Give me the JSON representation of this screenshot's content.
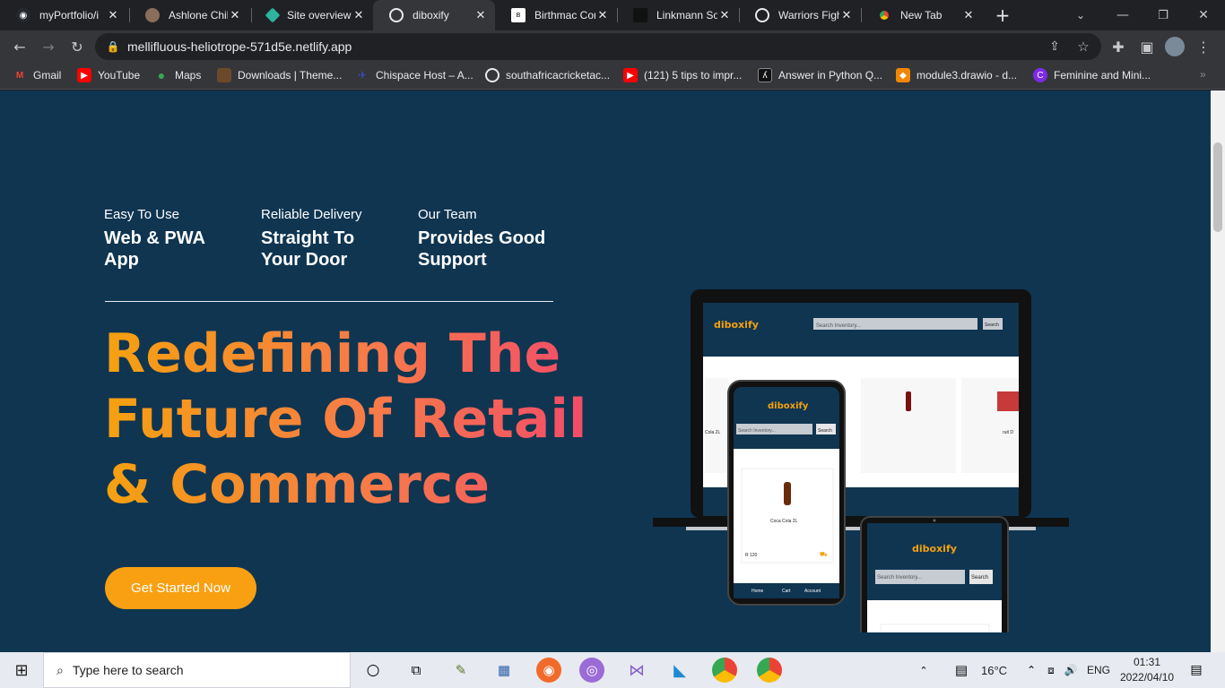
{
  "tabs": [
    {
      "title": "myPortfolio/i",
      "icon": "github-icon"
    },
    {
      "title": "Ashlone Chib",
      "icon": "person-icon"
    },
    {
      "title": "Site overview",
      "icon": "netlify-icon"
    },
    {
      "title": "diboxify",
      "icon": "globe-icon"
    },
    {
      "title": "Birthmac Con",
      "icon": "birthmac-icon"
    },
    {
      "title": "Linkmann So",
      "icon": "linkmann-icon"
    },
    {
      "title": "Warriors Figh",
      "icon": "globe-icon"
    },
    {
      "title": "New Tab",
      "icon": "chrome-icon"
    }
  ],
  "address_bar": {
    "url": "mellifluous-heliotrope-571d5e.netlify.app"
  },
  "bookmarks": [
    {
      "label": "Gmail",
      "icon": "gmail-icon",
      "color": "#ea4335"
    },
    {
      "label": "YouTube",
      "icon": "youtube-icon",
      "color": "#ff0000"
    },
    {
      "label": "Maps",
      "icon": "maps-icon",
      "color": "#34a853"
    },
    {
      "label": "Downloads | Theme...",
      "icon": "themeforest-icon",
      "color": "#6b4a2b"
    },
    {
      "label": "Chispace Host – A...",
      "icon": "chispace-icon",
      "color": "#3b4cc0"
    },
    {
      "label": "southafricacricketac...",
      "icon": "globe-icon",
      "color": "#5f6368"
    },
    {
      "label": "(121) 5 tips to impr...",
      "icon": "youtube-icon",
      "color": "#ff0000"
    },
    {
      "label": "Answer in Python Q...",
      "icon": "answer-icon",
      "color": "#111111"
    },
    {
      "label": "module3.drawio - d...",
      "icon": "drawio-icon",
      "color": "#f08705"
    },
    {
      "label": "Feminine and Mini...",
      "icon": "canva-icon",
      "color": "#7d2ae8"
    }
  ],
  "features": [
    {
      "label": "Easy To Use",
      "title": "Web & PWA App"
    },
    {
      "label": "Reliable Delivery",
      "title": "Straight To Your Door"
    },
    {
      "label": "Our Team",
      "title": "Provides Good Support"
    }
  ],
  "hero": {
    "headline_line1": "Redefining The",
    "headline_line2": "Future Of Retail",
    "headline_line3": "& Commerce",
    "cta_label": "Get Started Now",
    "gradient": [
      "#f5a10f",
      "#f7794a",
      "#f2486b"
    ],
    "cta_color": "#f8a012"
  },
  "mockup": {
    "brand": "diboxify",
    "search_placeholder": "Search Inventory...",
    "search_button": "Search",
    "product_name": "Coca Cola 2L",
    "product_name_short": "Cola 2L",
    "product_name_partial": "ruit D",
    "price": "R 120",
    "nav_home": "Home",
    "nav_cart": "Cart",
    "nav_account": "Account"
  },
  "taskbar": {
    "search_placeholder": "Type here to search",
    "temperature": "16°C",
    "language": "ENG",
    "time": "01:31",
    "date": "2022/04/10"
  },
  "colors": {
    "page_bg": "#0f3551",
    "accent_orange": "#f8a012",
    "brand_orange": "#f5a10f"
  }
}
